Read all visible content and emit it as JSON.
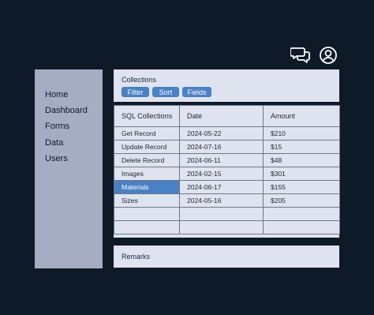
{
  "header": {
    "chat_icon": "chat-bubbles-icon",
    "user_icon": "user-circle-icon"
  },
  "sidebar": {
    "items": [
      {
        "label": "Home"
      },
      {
        "label": "Dashboard"
      },
      {
        "label": "Forms"
      },
      {
        "label": "Data"
      },
      {
        "label": "Users"
      }
    ]
  },
  "collections": {
    "title": "Collections",
    "buttons": {
      "filter": "Filter",
      "sort": "Sort",
      "fields": "Fields"
    }
  },
  "table": {
    "columns": [
      "SQL Collections",
      "Date",
      "Amount"
    ],
    "rows": [
      [
        "Get Record",
        "2024-05-22",
        "$210"
      ],
      [
        "Update Record",
        "2024-07-16",
        "$15"
      ],
      [
        "Delete Record",
        "2024-06-11",
        "$48"
      ],
      [
        "Images",
        "2024-02-15",
        "$301"
      ],
      [
        "Materials",
        "2024-06-17",
        "$155"
      ],
      [
        "Sizes",
        "2024-05-16",
        "$205"
      ],
      [
        "",
        "",
        ""
      ],
      [
        "",
        "",
        ""
      ]
    ],
    "selected_row": "Materials"
  },
  "remarks": {
    "label": "Remarks"
  },
  "colors": {
    "background": "#0e1a28",
    "sidebar": "#a6adc3",
    "panel": "#dfe3ef",
    "accent": "#4a80c4"
  }
}
